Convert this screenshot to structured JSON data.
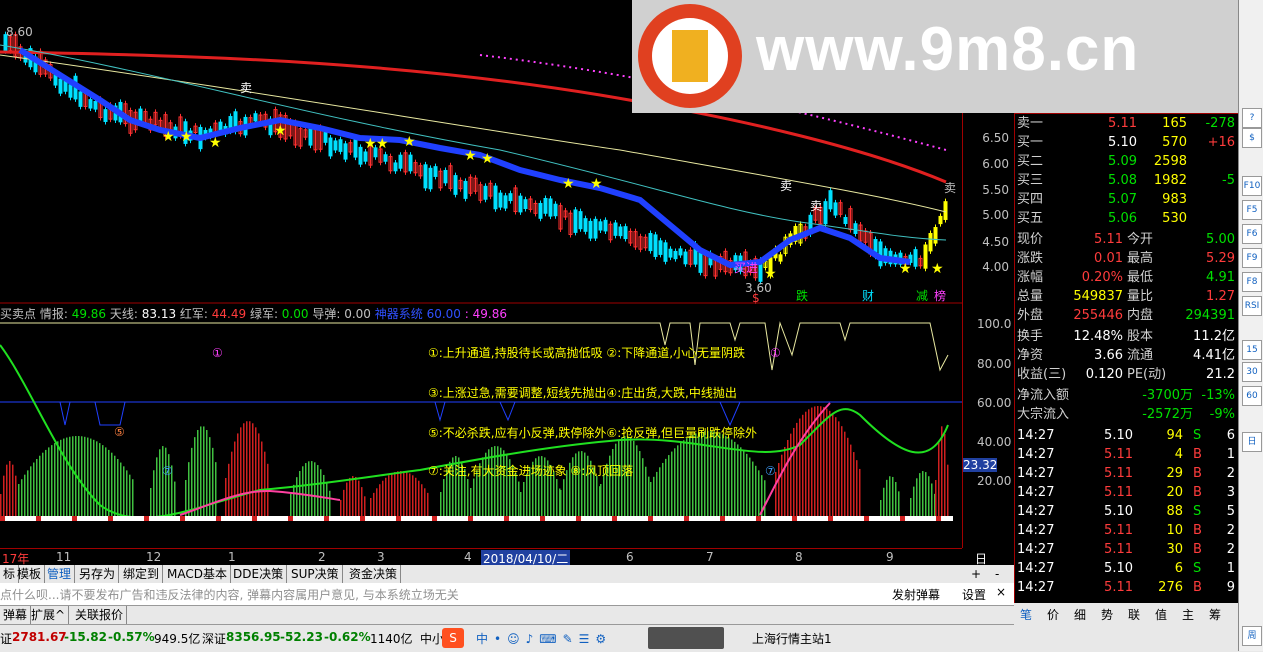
{
  "title_strip": "",
  "main_chart": {
    "high_label": "8.60",
    "low_label": "3.60",
    "sell_marks": [
      "卖",
      "卖",
      "卖",
      "卖"
    ],
    "buy_mark": "买进",
    "bottom_tags": [
      "$",
      "跌",
      "财",
      "减",
      "榜"
    ],
    "y_ticks": [
      "6.50",
      "6.00",
      "5.50",
      "5.00",
      "4.50",
      "4.00"
    ],
    "chart_data": {
      "type": "line",
      "ylim": [
        3.5,
        8.8
      ]
    }
  },
  "indicator": {
    "name": "买卖点",
    "values": [
      {
        "label": "情报:",
        "value": "49.86",
        "color": "#00e000"
      },
      {
        "label": "天线:",
        "value": "83.13",
        "color": "#ffffff"
      },
      {
        "label": "红军:",
        "value": "44.49",
        "color": "#ff3c3c"
      },
      {
        "label": "绿军:",
        "value": "0.00",
        "color": "#00e000"
      },
      {
        "label": "导弹:",
        "value": "0.00",
        "color": "#c0c0c0"
      },
      {
        "label": "神器系统",
        "value": "60.00",
        "color": "#3050ff"
      },
      {
        "label": ":",
        "value": "49.86",
        "color": "#ff40ff"
      }
    ],
    "y_ticks": [
      "100.0",
      "80.00",
      "60.00",
      "40.00",
      "20.00"
    ],
    "current_value": "23.32",
    "notes": [
      "①:上升通道,持股待长或高抛低吸 ②:下降通道,小心无量阴跌",
      "③:上涨过急,需要调整,短线先抛出④:庄出货,大跌,中线抛出",
      "⑤:不必杀跌,应有小反弹,跌停除外⑥:抢反弹,但巨量刷跌停除外",
      "⑦:关注,有大资金进场迹象   ⑧:风顶回落"
    ],
    "circle_marks": [
      "①",
      "⑤",
      "⑦",
      "①",
      "⑦"
    ]
  },
  "date_axis": {
    "labels": [
      "17年",
      "11",
      "12",
      "1",
      "2",
      "3",
      "4",
      "2018/04/10/二",
      "6",
      "7",
      "8",
      "9"
    ],
    "period": "日线"
  },
  "toolbar": [
    "标",
    "模板",
    "管理",
    "另存为",
    "绑定到",
    "MACD基本",
    "DDE决策",
    "SUP决策",
    "资金决策"
  ],
  "toolbar_right": [
    "+",
    "-"
  ],
  "danmu": {
    "placeholder": "点什么呗...请不要发布广告和违反法律的内容, 弹幕内容属用户意见, 与本系统立场无关",
    "send": "发射弹幕",
    "settings": "设置",
    "close": "×"
  },
  "tabs": [
    "弹幕",
    "扩展^",
    "关联报价"
  ],
  "banner": {
    "logo_text": "www.9m8.cn",
    "watermark": "www.9m8.cn"
  },
  "quote": {
    "asks": [
      {
        "label": "卖一",
        "price": "5.11",
        "vol": "165",
        "chg": "-278"
      }
    ],
    "bids": [
      {
        "label": "买一",
        "price": "5.10",
        "vol": "570",
        "chg": "+16"
      },
      {
        "label": "买二",
        "price": "5.09",
        "vol": "2598",
        "chg": ""
      },
      {
        "label": "买三",
        "price": "5.08",
        "vol": "1982",
        "chg": "-5"
      },
      {
        "label": "买四",
        "price": "5.07",
        "vol": "983",
        "chg": ""
      },
      {
        "label": "买五",
        "price": "5.06",
        "vol": "530",
        "chg": ""
      }
    ],
    "stats": [
      {
        "l1": "现价",
        "v1": "5.11",
        "c1": "#ff3c3c",
        "l2": "今开",
        "v2": "5.00",
        "c2": "#00e000"
      },
      {
        "l1": "涨跌",
        "v1": "0.01",
        "c1": "#ff3c3c",
        "l2": "最高",
        "v2": "5.29",
        "c2": "#ff3c3c"
      },
      {
        "l1": "涨幅",
        "v1": "0.20%",
        "c1": "#ff3c3c",
        "l2": "最低",
        "v2": "4.91",
        "c2": "#00e000"
      },
      {
        "l1": "总量",
        "v1": "549837",
        "c1": "#ffff00",
        "l2": "量比",
        "v2": "1.27",
        "c2": "#ff3c3c"
      },
      {
        "l1": "外盘",
        "v1": "255446",
        "c1": "#ff3c3c",
        "l2": "内盘",
        "v2": "294391",
        "c2": "#00e000"
      }
    ],
    "fundamentals": [
      {
        "l1": "换手",
        "v1": "12.48%",
        "l2": "股本",
        "v2": "11.2亿"
      },
      {
        "l1": "净资",
        "v1": "3.66",
        "l2": "流通",
        "v2": "4.41亿"
      },
      {
        "l1": "收益(三)",
        "v1": "0.120",
        "l2": "PE(动)",
        "v2": "21.2"
      }
    ],
    "flows": [
      {
        "label": "净流入额",
        "value": "-3700万",
        "pct": "-13%"
      },
      {
        "label": "大宗流入",
        "value": "-2572万",
        "pct": "-9%"
      }
    ],
    "ticks": [
      {
        "time": "14:27",
        "price": "5.10",
        "vol": "94",
        "side": "S",
        "n": "6"
      },
      {
        "time": "14:27",
        "price": "5.11",
        "vol": "4",
        "side": "B",
        "n": "1"
      },
      {
        "time": "14:27",
        "price": "5.11",
        "vol": "29",
        "side": "B",
        "n": "2"
      },
      {
        "time": "14:27",
        "price": "5.11",
        "vol": "20",
        "side": "B",
        "n": "3"
      },
      {
        "time": "14:27",
        "price": "5.10",
        "vol": "88",
        "side": "S",
        "n": "5"
      },
      {
        "time": "14:27",
        "price": "5.11",
        "vol": "10",
        "side": "B",
        "n": "2"
      },
      {
        "time": "14:27",
        "price": "5.11",
        "vol": "30",
        "side": "B",
        "n": "2"
      },
      {
        "time": "14:27",
        "price": "5.10",
        "vol": "6",
        "side": "S",
        "n": "1"
      },
      {
        "time": "14:27",
        "price": "5.11",
        "vol": "276",
        "side": "B",
        "n": "9"
      }
    ],
    "tabs": [
      "笔",
      "价",
      "细",
      "势",
      "联",
      "值",
      "主",
      "筹"
    ]
  },
  "right_bar": [
    "?",
    "$",
    "F10",
    "F5",
    "F6",
    "F9",
    "F8",
    "RSI",
    "15",
    "30",
    "60",
    "日",
    "周"
  ],
  "status": {
    "sh_label": "证",
    "sh_index": "2781.67",
    "sh_chg": "-15.82",
    "sh_pct": "-0.57%",
    "sh_amt": "949.5亿",
    "sz_label": "深证",
    "sz_index": "8356.95",
    "sz_chg": "-52.23",
    "sz_pct": "-0.62%",
    "sz_amt": "1140亿",
    "ime_text": "中小",
    "server": "上海行情主站1"
  }
}
